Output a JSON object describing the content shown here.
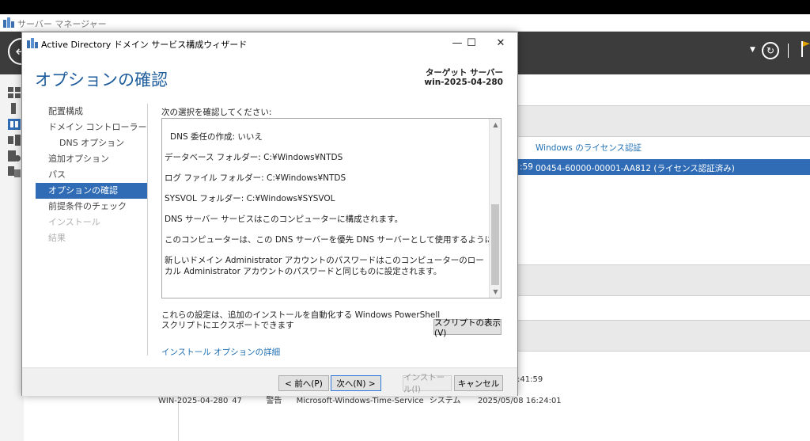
{
  "server_manager": {
    "title": "サーバー マネージャー",
    "table": {
      "column_header": "Windows のライセンス認証",
      "selected_row": {
        "time": ":59",
        "license_key": "00454-60000-00001-AA812 (ライセンス認証済み)"
      }
    },
    "events": {
      "time_top": ":41:59",
      "row": {
        "server": "WIN-2025-04-280",
        "id": "47",
        "level": "警告",
        "source": "Microsoft-Windows-Time-Service",
        "log": "システム",
        "datetime": "2025/05/08 16:24:01"
      }
    },
    "icons": {
      "back": "back-arrow-icon",
      "refresh": "refresh-icon",
      "notifications": "flag-icon"
    }
  },
  "wizard": {
    "title": "Active Directory ドメイン サービス構成ウィザード",
    "window_buttons": {
      "minimize": "—",
      "maximize": "☐",
      "close": "✕"
    },
    "heading": "オプションの確認",
    "target_server": {
      "label": "ターゲット サーバー",
      "name": "win-2025-04-280"
    },
    "steps": [
      {
        "label": "配置構成",
        "state": "normal",
        "sub": false
      },
      {
        "label": "ドメイン コントローラー オプシ...",
        "state": "normal",
        "sub": false
      },
      {
        "label": "DNS オプション",
        "state": "normal",
        "sub": true
      },
      {
        "label": "追加オプション",
        "state": "normal",
        "sub": false
      },
      {
        "label": "パス",
        "state": "normal",
        "sub": false
      },
      {
        "label": "オプションの確認",
        "state": "active",
        "sub": false
      },
      {
        "label": "前提条件のチェック",
        "state": "normal",
        "sub": false
      },
      {
        "label": "インストール",
        "state": "disabled",
        "sub": false
      },
      {
        "label": "結果",
        "state": "disabled",
        "sub": false
      }
    ],
    "review": {
      "label": "次の選択を確認してください:",
      "lines": [
        "DNS 委任の作成: いいえ",
        "データベース フォルダー: C:¥Windows¥NTDS",
        "ログ ファイル フォルダー: C:¥Windows¥NTDS",
        "SYSVOL フォルダー: C:¥Windows¥SYSVOL",
        "DNS サーバー サービスはこのコンピューターに構成されます。",
        "このコンピューターは、この DNS サーバーを優先 DNS サーバーとして使用するように構成されます。",
        "新しいドメイン Administrator アカウントのパスワードはこのコンピューターのローカル Administrator アカウントのパスワードと同じものに設定されます。"
      ]
    },
    "export_text": "これらの設定は、追加のインストールを自動化する Windows PowerShell スクリプトにエクスポートできます",
    "view_script_button": "スクリプトの表示(V)",
    "more_link": "インストール オプションの詳細",
    "footer": {
      "back": "< 前へ(P)",
      "next": "次へ(N) >",
      "install": "インストール(I)",
      "cancel": "キャンセル"
    }
  }
}
